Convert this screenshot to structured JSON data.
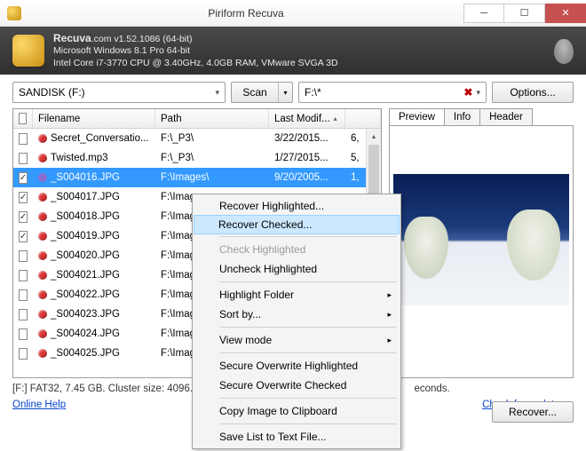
{
  "titlebar": {
    "title": "Piriform Recuva"
  },
  "header": {
    "brand": "Recuva",
    "domain": ".com",
    "version": "v1.52.1086 (64-bit)",
    "os": "Microsoft Windows 8.1 Pro 64-bit",
    "hw": "Intel Core i7-3770 CPU @ 3.40GHz, 4.0GB RAM, VMware SVGA 3D"
  },
  "toolbar": {
    "drive": "SANDISK (F:)",
    "scan_label": "Scan",
    "path": "F:\\*",
    "options_label": "Options..."
  },
  "columns": {
    "filename": "Filename",
    "path": "Path",
    "modified": "Last Modif..."
  },
  "rows": [
    {
      "cb": false,
      "dot": "r",
      "name": "Secret_Conversatio...",
      "path": "F:\\_P3\\",
      "mod": "3/22/2015...",
      "x": "6,"
    },
    {
      "cb": false,
      "dot": "r",
      "name": "Twisted.mp3",
      "path": "F:\\_P3\\",
      "mod": "1/27/2015...",
      "x": "5,"
    },
    {
      "cb": true,
      "dot": "p",
      "name": "_S004016.JPG",
      "path": "F:\\Images\\",
      "mod": "9/20/2005...",
      "x": "1,",
      "sel": true
    },
    {
      "cb": true,
      "dot": "r",
      "name": "_S004017.JPG",
      "path": "F:\\Imag",
      "mod": "",
      "x": ""
    },
    {
      "cb": true,
      "dot": "r",
      "name": "_S004018.JPG",
      "path": "F:\\Imag",
      "mod": "",
      "x": ""
    },
    {
      "cb": true,
      "dot": "r",
      "name": "_S004019.JPG",
      "path": "F:\\Imag",
      "mod": "",
      "x": ""
    },
    {
      "cb": false,
      "dot": "r",
      "name": "_S004020.JPG",
      "path": "F:\\Imag",
      "mod": "",
      "x": ""
    },
    {
      "cb": false,
      "dot": "r",
      "name": "_S004021.JPG",
      "path": "F:\\Imag",
      "mod": "",
      "x": ""
    },
    {
      "cb": false,
      "dot": "r",
      "name": "_S004022.JPG",
      "path": "F:\\Imag",
      "mod": "",
      "x": ""
    },
    {
      "cb": false,
      "dot": "r",
      "name": "_S004023.JPG",
      "path": "F:\\Imag",
      "mod": "",
      "x": ""
    },
    {
      "cb": false,
      "dot": "r",
      "name": "_S004024.JPG",
      "path": "F:\\Imag",
      "mod": "",
      "x": ""
    },
    {
      "cb": false,
      "dot": "r",
      "name": "_S004025.JPG",
      "path": "F:\\Imag",
      "mod": "",
      "x": ""
    }
  ],
  "tabs": {
    "preview": "Preview",
    "info": "Info",
    "header": "Header"
  },
  "status": "[F:] FAT32, 7.45 GB. Cluster size: 4096. F",
  "status_suffix": "econds.",
  "recover_label": "Recover...",
  "footer": {
    "help": "Online Help",
    "updates": "Check for updates..."
  },
  "context_menu": {
    "recover_highlighted": "Recover Highlighted...",
    "recover_checked": "Recover Checked...",
    "check_highlighted": "Check Highlighted",
    "uncheck_highlighted": "Uncheck Highlighted",
    "highlight_folder": "Highlight Folder",
    "sort_by": "Sort by...",
    "view_mode": "View mode",
    "secure_ow_h": "Secure Overwrite Highlighted",
    "secure_ow_c": "Secure Overwrite Checked",
    "copy_image": "Copy Image to Clipboard",
    "save_list": "Save List to Text File..."
  }
}
